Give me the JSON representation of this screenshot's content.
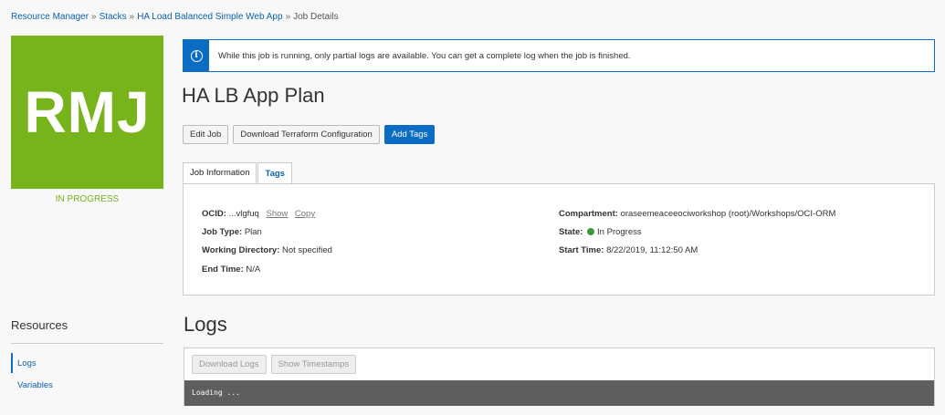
{
  "breadcrumb": {
    "items": [
      "Resource Manager",
      "Stacks",
      "HA Load Balanced Simple Web App"
    ],
    "current": "Job Details",
    "separator": "»"
  },
  "tile": {
    "text": "RMJ",
    "color": "#77b41c",
    "status": "IN PROGRESS"
  },
  "banner": {
    "icon": "info-icon",
    "message": "While this job is running, only partial logs are available. You can get a complete log when the job is finished."
  },
  "title": "HA LB App Plan",
  "actions": {
    "edit": "Edit Job",
    "download": "Download Terraform Configuration",
    "add_tags": "Add Tags"
  },
  "tabs": {
    "job_info": "Job Information",
    "tags": "Tags"
  },
  "job_info": {
    "ocid_label": "OCID:",
    "ocid_value": "...vlgfuq",
    "ocid_show": "Show",
    "ocid_copy": "Copy",
    "job_type_label": "Job Type:",
    "job_type_value": "Plan",
    "working_dir_label": "Working Directory:",
    "working_dir_value": "Not specified",
    "end_time_label": "End Time:",
    "end_time_value": "N/A",
    "compartment_label": "Compartment:",
    "compartment_value": "oraseemeaceeociworkshop (root)/Workshops/OCI-ORM",
    "state_label": "State:",
    "state_value": "In Progress",
    "start_time_label": "Start Time:",
    "start_time_value": "8/22/2019, 11:12:50 AM"
  },
  "resources": {
    "title": "Resources",
    "items": [
      "Logs",
      "Variables"
    ]
  },
  "logs": {
    "title": "Logs",
    "download": "Download Logs",
    "timestamps": "Show Timestamps",
    "console_text": "Loading ..."
  }
}
